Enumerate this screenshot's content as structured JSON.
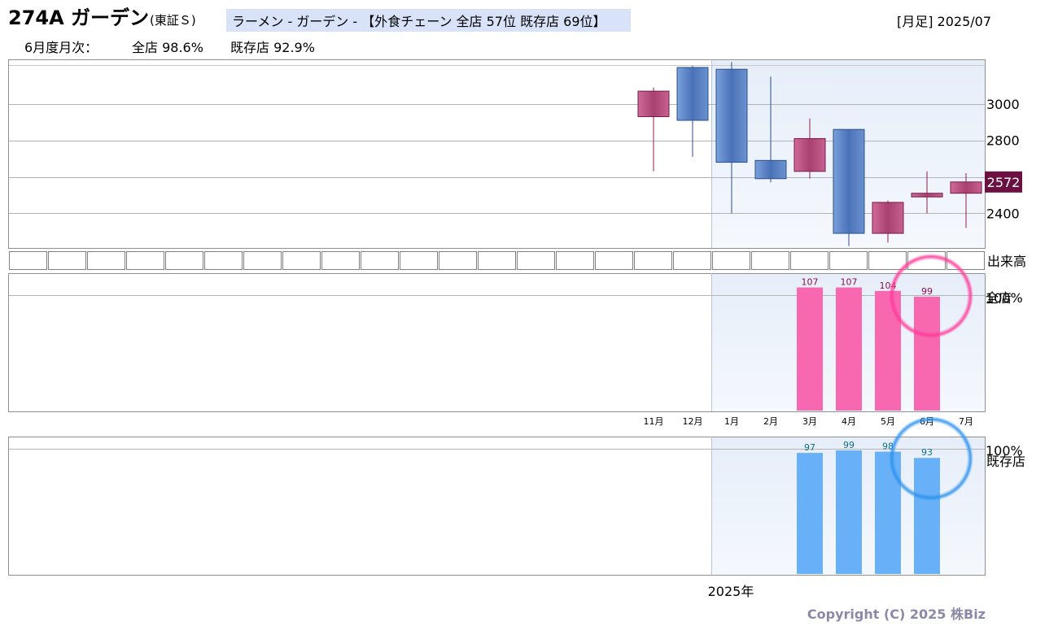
{
  "header": {
    "title": "274A ガーデン",
    "exchange": "(東証Ｓ)",
    "category": "ラーメン - ガーデン - 【外食チェーン 全店 57位 既存店 69位】",
    "period": "[月足] 2025/07",
    "monthly_label": "6月度月次：",
    "all_store_label": "全店 98.6%",
    "existing_store_label": "既存店 92.9%"
  },
  "price_chart": {
    "last_price": "2572",
    "volume_label": "出来高",
    "highlight_color": "#6b1040"
  },
  "year_label": "2025年",
  "copyright": "Copyright (C) 2025 株Biz",
  "chart_data": [
    {
      "type": "candlestick",
      "categories": [
        "11月",
        "12月",
        "1月",
        "2月",
        "3月",
        "4月",
        "5月",
        "6月",
        "7月"
      ],
      "ohlc": [
        {
          "open": 2930,
          "high": 3090,
          "low": 2630,
          "close": 3070
        },
        {
          "open": 3200,
          "high": 3210,
          "low": 2710,
          "close": 2910
        },
        {
          "open": 3190,
          "high": 3230,
          "low": 2400,
          "close": 2680
        },
        {
          "open": 2690,
          "high": 3150,
          "low": 2570,
          "close": 2590
        },
        {
          "open": 2630,
          "high": 2920,
          "low": 2590,
          "close": 2810
        },
        {
          "open": 2860,
          "high": 2860,
          "low": 2220,
          "close": 2290
        },
        {
          "open": 2290,
          "high": 2470,
          "low": 2240,
          "close": 2460
        },
        {
          "open": 2490,
          "high": 2630,
          "low": 2400,
          "close": 2510
        },
        {
          "open": 2510,
          "high": 2620,
          "low": 2320,
          "close": 2572
        }
      ],
      "ylim": [
        2210,
        3240
      ],
      "yticks": [
        2400,
        2600,
        2800,
        3000
      ],
      "yticks_labeled": [
        "2400",
        "2800",
        "3000"
      ],
      "up_color": "#c05080",
      "down_color": "#4a78c0"
    },
    {
      "type": "bar",
      "label": "全店",
      "reference_label": "100%",
      "categories": [
        "11月",
        "12月",
        "1月",
        "2月",
        "3月",
        "4月",
        "5月",
        "6月",
        "7月"
      ],
      "values": [
        null,
        null,
        null,
        null,
        107,
        107,
        104,
        99,
        null
      ],
      "value_labels": [
        "",
        "",
        "",
        "",
        "107",
        "107",
        "104",
        "99",
        ""
      ],
      "color": "#f868b0",
      "label_color": "#8a1050"
    },
    {
      "type": "bar",
      "label": "既存店",
      "reference_label": "100%",
      "categories": [
        "11月",
        "12月",
        "1月",
        "2月",
        "3月",
        "4月",
        "5月",
        "6月",
        "7月"
      ],
      "values": [
        null,
        null,
        null,
        null,
        97,
        99,
        98,
        93,
        null
      ],
      "value_labels": [
        "",
        "",
        "",
        "",
        "97",
        "99",
        "98",
        "93",
        ""
      ],
      "color": "#68b0f8",
      "label_color": "#10708a"
    }
  ]
}
